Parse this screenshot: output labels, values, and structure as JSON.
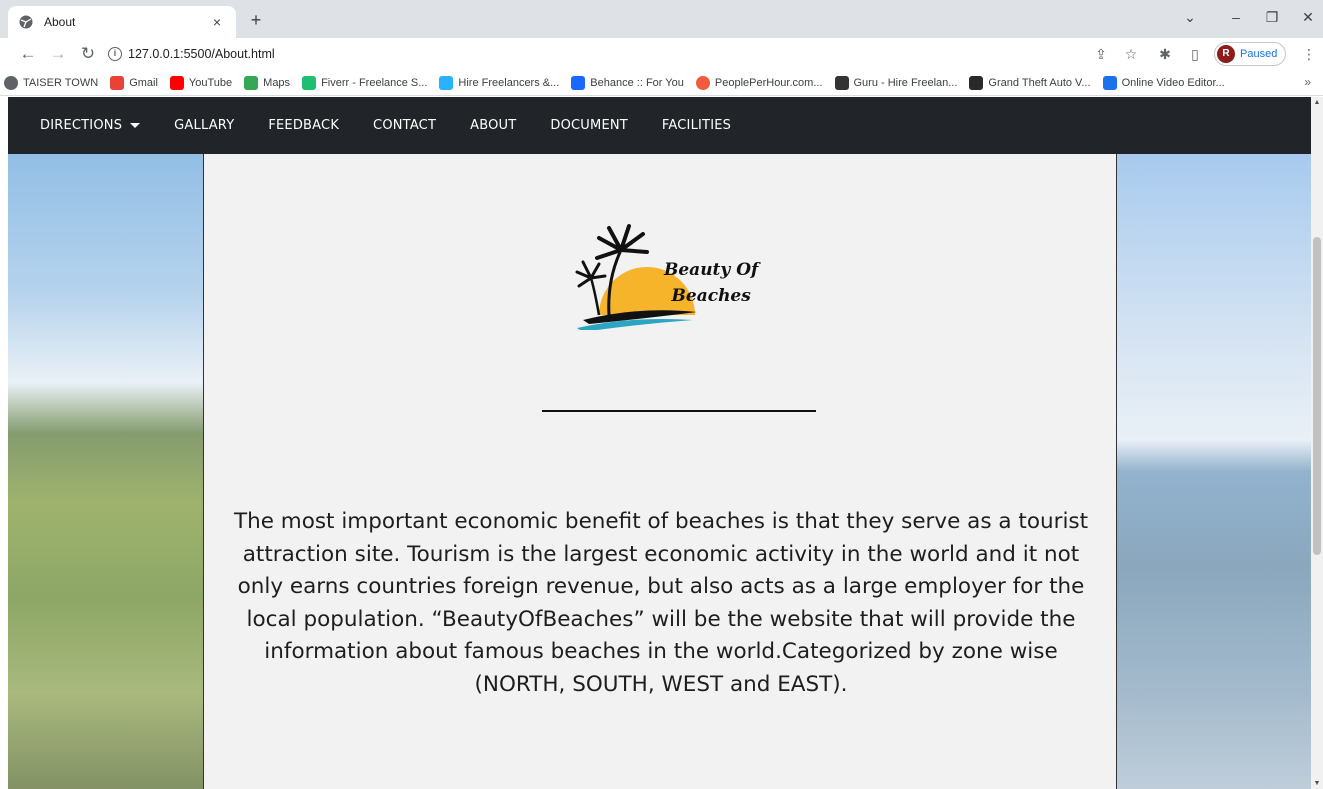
{
  "browser": {
    "tab_title": "About",
    "tab_close": "×",
    "new_tab": "+",
    "url": "127.0.0.1:5500/About.html",
    "profile_initial": "R",
    "profile_status": "Paused",
    "bookmarks": [
      {
        "label": "TAISER TOWN",
        "icon": "globe-icon",
        "color": "#5f6368"
      },
      {
        "label": "Gmail",
        "icon": "gmail-icon",
        "color": "#ea4335"
      },
      {
        "label": "YouTube",
        "icon": "youtube-icon",
        "color": "#ff0000"
      },
      {
        "label": "Maps",
        "icon": "maps-icon",
        "color": "#34a853"
      },
      {
        "label": "Fiverr - Freelance S...",
        "icon": "fiverr-icon",
        "color": "#1dbf73"
      },
      {
        "label": "Hire Freelancers &...",
        "icon": "freelancer-icon",
        "color": "#29b2fe"
      },
      {
        "label": "Behance :: For You",
        "icon": "behance-icon",
        "color": "#1769ff"
      },
      {
        "label": "PeoplePerHour.com...",
        "icon": "pph-icon",
        "color": "#f25c3d"
      },
      {
        "label": "Guru - Hire Freelan...",
        "icon": "guru-icon",
        "color": "#333333"
      },
      {
        "label": "Grand Theft Auto V...",
        "icon": "epic-icon",
        "color": "#2a2a2a"
      },
      {
        "label": "Online Video Editor...",
        "icon": "video-editor-icon",
        "color": "#1a73e8"
      }
    ]
  },
  "nav": {
    "items": [
      "DIRECTIONS",
      "GALLARY",
      "FEEDBACK",
      "CONTACT",
      "ABOUT",
      "DOCUMENT",
      "FACILITIES"
    ]
  },
  "logo": {
    "line1": "Beauty Of",
    "line2": "Beaches",
    "sun_color": "#f5b429",
    "wave_color": "#2aa6c4"
  },
  "about": {
    "text": "The most important economic benefit of beaches is that they serve as a tourist attraction site. Tourism is the largest economic activity in the world and it not only earns countries foreign revenue, but also acts as a large employer for the local population. “BeautyOfBeaches” will be the website that will provide the information about famous beaches in the world.Categorized by zone wise (NORTH, SOUTH, WEST and EAST)."
  },
  "colors": {
    "navbar": "#212529",
    "content_bg": "#f2f2f2"
  }
}
